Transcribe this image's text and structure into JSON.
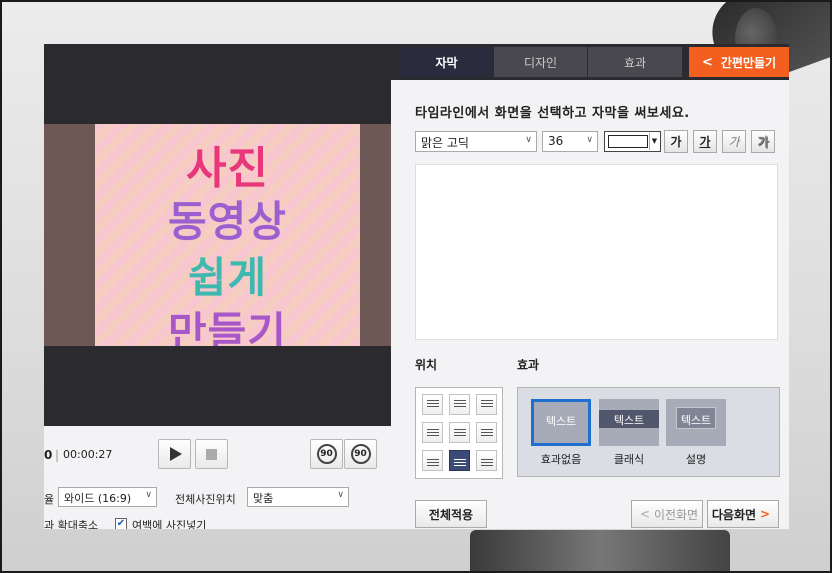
{
  "player": {
    "time_left": "0",
    "time_current": "00:00:27",
    "title_lines": [
      "사진",
      "동영상",
      "쉽게",
      "만들기"
    ],
    "rotate_cw": "90",
    "rotate_ccw": "90"
  },
  "options": {
    "ratio_label_cut": "율",
    "ratio_value": "와이드 (16:9)",
    "photo_pos_label": "전체사진위치",
    "photo_pos_value": "맞춤",
    "zoom_label_cut": "과 확대축소",
    "fill_checkbox_label": "여백에 사진넣기",
    "fill_checked": true
  },
  "tabs": [
    {
      "label": "자막",
      "active": true
    },
    {
      "label": "디자인",
      "active": false
    },
    {
      "label": "효과",
      "active": false
    }
  ],
  "quick_make": {
    "label": "간편만들기",
    "color": "#f25f1e"
  },
  "subtitle": {
    "instruction": "타임라인에서 화면을 선택하고 자막을 써보세요.",
    "font_family": "맑은 고딕",
    "font_size": "36",
    "text_color": "#ffffff",
    "style_buttons": [
      "가",
      "가",
      "가",
      "가"
    ],
    "text_value": ""
  },
  "position": {
    "label": "위치",
    "selected": "bottom-center"
  },
  "effect": {
    "label": "효과",
    "items": [
      {
        "preview": "텍스트",
        "name": "효과없음",
        "selected": true
      },
      {
        "preview": "텍스트",
        "name": "클래식",
        "selected": false
      },
      {
        "preview": "텍스트",
        "name": "설명",
        "selected": false
      }
    ]
  },
  "footer": {
    "apply_all": "전체적용",
    "prev": "이전화면",
    "next": "다음화면"
  }
}
